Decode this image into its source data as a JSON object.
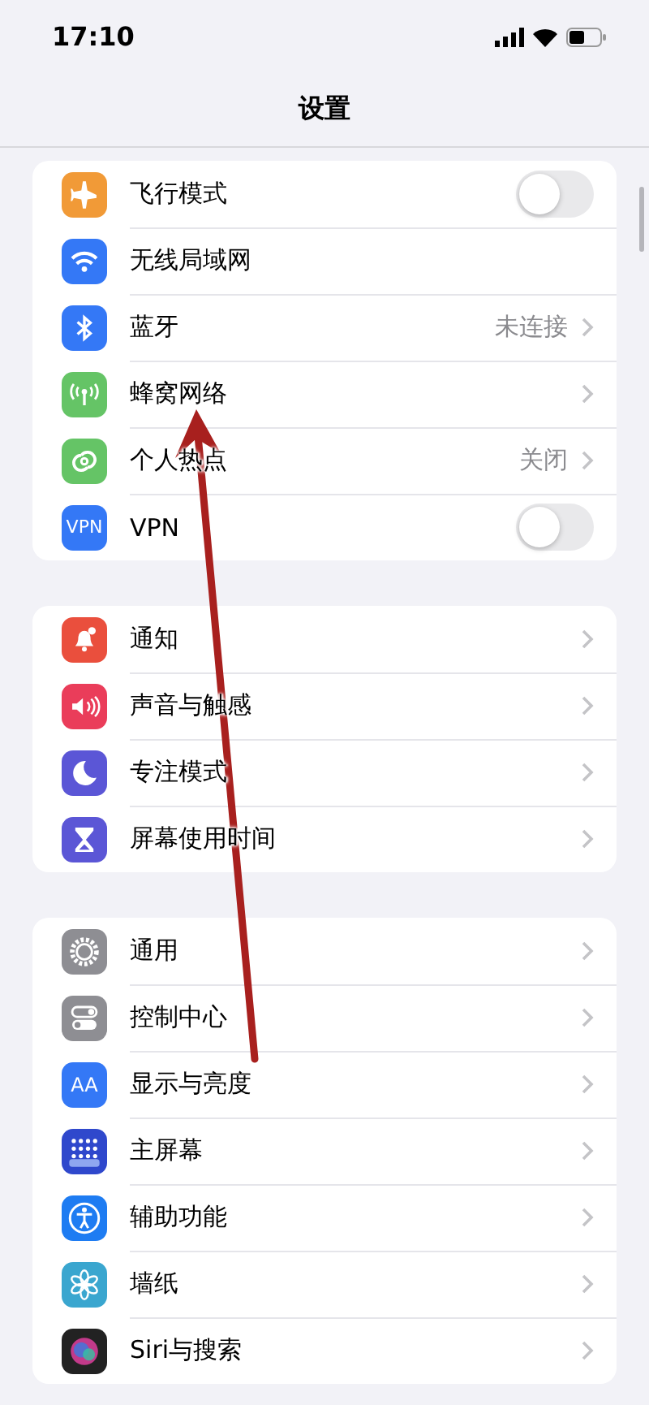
{
  "status_bar": {
    "time": "17:10"
  },
  "title": "设置",
  "groups": [
    {
      "items": [
        {
          "label": "飞行模式",
          "kind": "toggle",
          "on": false
        },
        {
          "label": "无线局域网",
          "kind": "plain"
        },
        {
          "label": "蓝牙",
          "kind": "link",
          "value": "未连接"
        },
        {
          "label": "蜂窝网络",
          "kind": "link"
        },
        {
          "label": "个人热点",
          "kind": "link",
          "value": "关闭"
        },
        {
          "label": "VPN",
          "kind": "toggle",
          "on": false,
          "icon_text": "VPN"
        }
      ]
    },
    {
      "items": [
        {
          "label": "通知",
          "kind": "link"
        },
        {
          "label": "声音与触感",
          "kind": "link"
        },
        {
          "label": "专注模式",
          "kind": "link"
        },
        {
          "label": "屏幕使用时间",
          "kind": "link"
        }
      ]
    },
    {
      "items": [
        {
          "label": "通用",
          "kind": "link"
        },
        {
          "label": "控制中心",
          "kind": "link"
        },
        {
          "label": "显示与亮度",
          "kind": "link",
          "icon_text": "AA"
        },
        {
          "label": "主屏幕",
          "kind": "link"
        },
        {
          "label": "辅助功能",
          "kind": "link"
        },
        {
          "label": "墙纸",
          "kind": "link"
        },
        {
          "label": "Siri与搜索",
          "kind": "link"
        }
      ]
    }
  ]
}
